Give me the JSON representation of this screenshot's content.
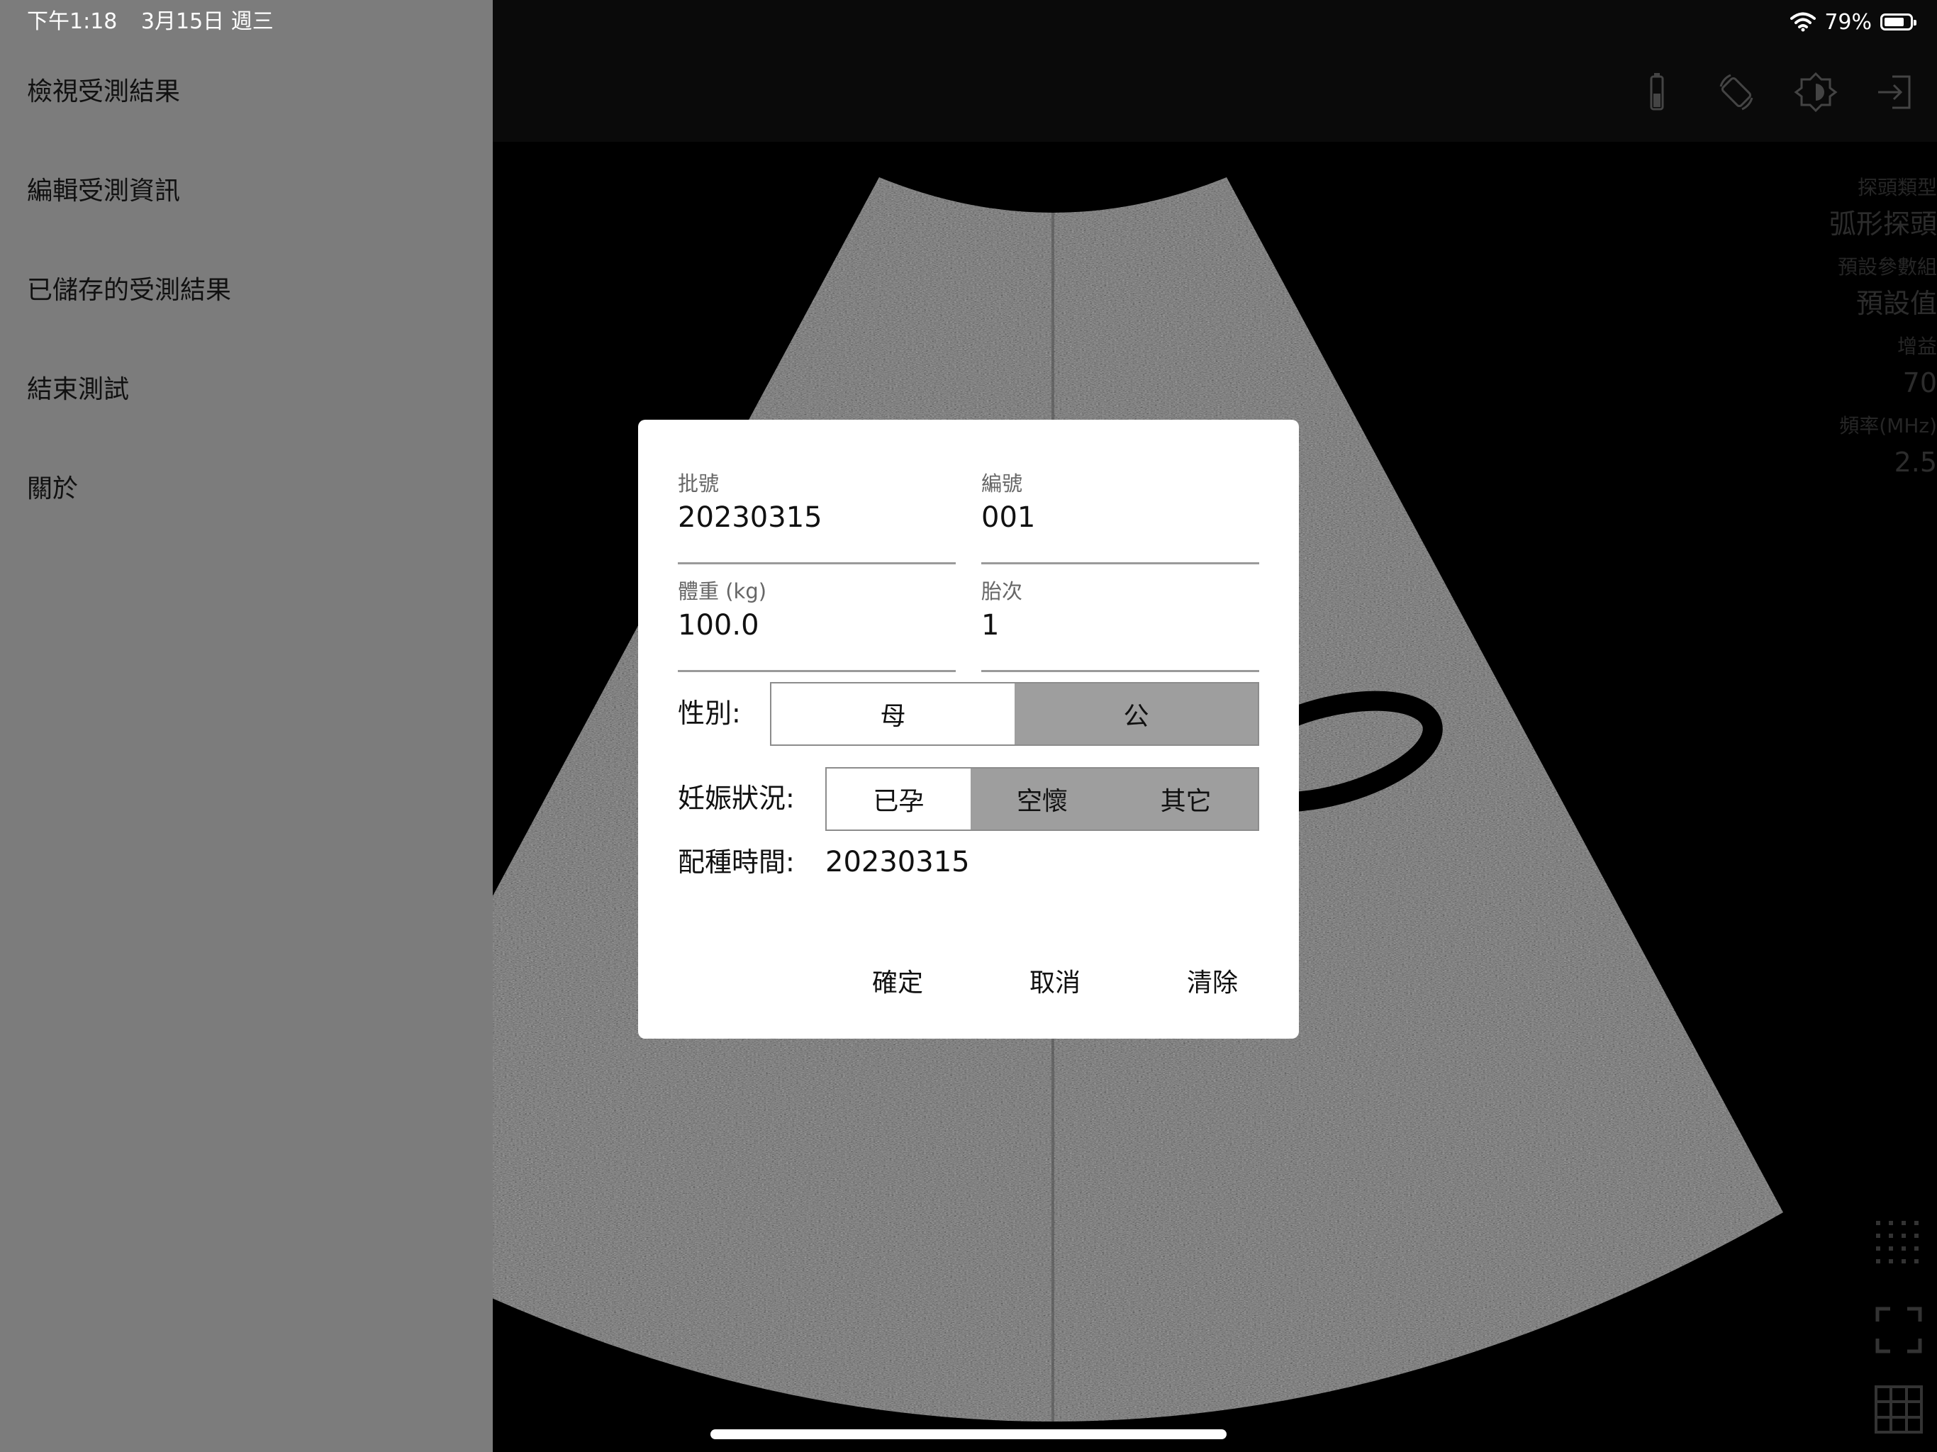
{
  "status_bar": {
    "time": "下午1:18",
    "date": "3月15日 週三",
    "battery_percent": "79%",
    "battery_level": 0.79
  },
  "side_menu": {
    "items": [
      {
        "label": "檢視受測結果"
      },
      {
        "label": "編輯受測資訊"
      },
      {
        "label": "已儲存的受測結果"
      },
      {
        "label": "結束測試"
      },
      {
        "label": "關於"
      }
    ]
  },
  "toolbar": {
    "icons": [
      "battery-icon",
      "rotate-screen-icon",
      "brightness-icon",
      "exit-icon"
    ]
  },
  "info_panel": {
    "probe_type_label": "探頭類型",
    "probe_type_value": "弧形探頭",
    "preset_label": "預設參數組",
    "preset_value": "預設值",
    "gain_label": "增益",
    "gain_value": "70",
    "frequency_label": "頻率(MHz)",
    "frequency_value": "2.5"
  },
  "bottom_icons": [
    "dotted-grid-icon",
    "fullscreen-icon",
    "grid-icon"
  ],
  "dialog": {
    "batch_label": "批號",
    "batch_value": "20230315",
    "number_label": "編號",
    "number_value": "001",
    "weight_label": "體重 (kg)",
    "weight_value": "100.0",
    "parity_label": "胎次",
    "parity_value": "1",
    "sex_label": "性別:",
    "sex_options": [
      {
        "label": "母",
        "selected": true
      },
      {
        "label": "公",
        "selected": false
      }
    ],
    "pregnancy_label": "妊娠狀況:",
    "pregnancy_options": [
      {
        "label": "已孕",
        "selected": true
      },
      {
        "label": "空懷",
        "selected": false
      },
      {
        "label": "其它",
        "selected": false
      }
    ],
    "breeding_time_label": "配種時間:",
    "breeding_time_value": "20230315",
    "confirm_label": "確定",
    "cancel_label": "取消",
    "clear_label": "清除"
  }
}
